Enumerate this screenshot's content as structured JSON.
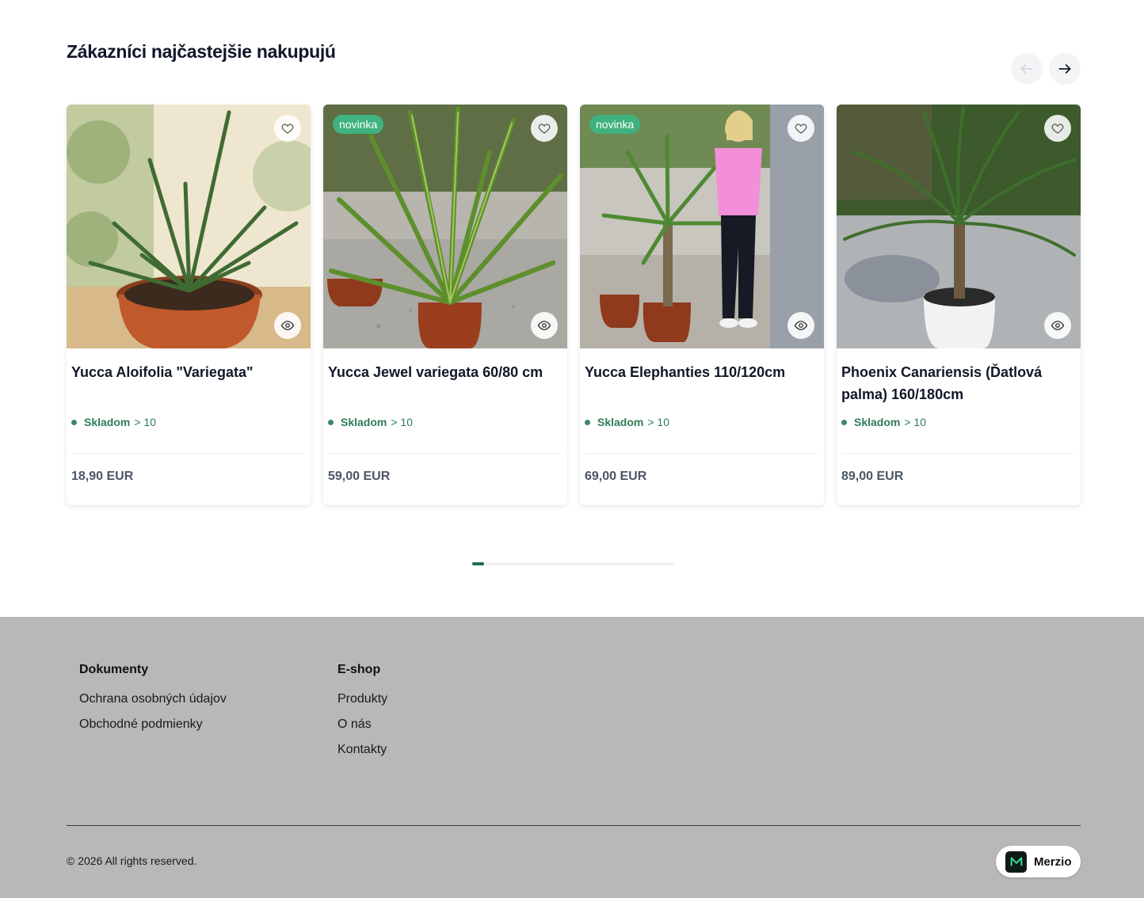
{
  "section": {
    "title": "Zákazníci najčastejšie nakupujú"
  },
  "carousel": {
    "prev_icon": "arrow-left-icon",
    "next_icon": "arrow-right-icon",
    "progress": 0.06
  },
  "products": [
    {
      "name": "Yucca Aloifolia \"Variegata\"",
      "badge": "",
      "stock_label": "Skladom",
      "stock_count": "> 10",
      "price": "18,90 EUR"
    },
    {
      "name": "Yucca Jewel variegata 60/80 cm",
      "badge": "novinka",
      "stock_label": "Skladom",
      "stock_count": "> 10",
      "price": "59,00 EUR"
    },
    {
      "name": "Yucca Elephanties 110/120cm",
      "badge": "novinka",
      "stock_label": "Skladom",
      "stock_count": "> 10",
      "price": "69,00 EUR"
    },
    {
      "name": "Phoenix Canariensis (Ďatlová palma) 160/180cm",
      "badge": "",
      "stock_label": "Skladom",
      "stock_count": "> 10",
      "price": "89,00 EUR"
    }
  ],
  "footer": {
    "columns": [
      {
        "title": "Dokumenty",
        "links": [
          "Ochrana osobných údajov",
          "Obchodné podmienky"
        ]
      },
      {
        "title": "E-shop",
        "links": [
          "Produkty",
          "O nás",
          "Kontakty"
        ]
      }
    ],
    "copyright": "© 2026 All rights reserved.",
    "brand": "Merzio",
    "brand_logo_text": "M"
  },
  "colors": {
    "accent": "#3fb27f",
    "stock": "#2f7d57",
    "footer_bg": "#b8b8b8",
    "progress": "#1f6f4a"
  }
}
